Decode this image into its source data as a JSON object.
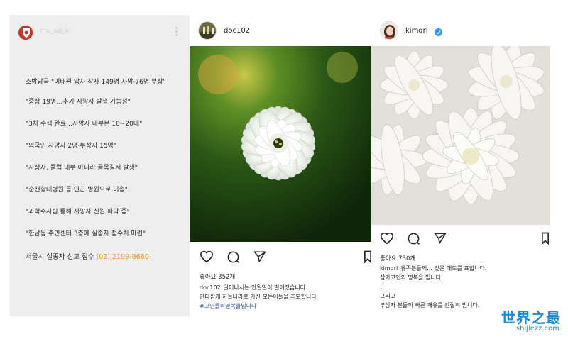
{
  "story": {
    "username": "mu_sio_k",
    "lines": [
      "소방당국 \"이태원 압사 참사 149명 사망·76명 부상\"",
      "\"중상 19명…추가 사망자 발생 가능성\"",
      "\"3차 수색 완료…사망자 대부분 10~20대\"",
      "\"외국인 사망자 2명·부상자 15명\"",
      "\"사상자, 클럽 내부 아니라 골목길서 발생\"",
      "\"순천향대병원 등 인근 병원으로 이송\"",
      "\"과학수사팀 통해 사망자 신원 파악 중\"",
      "\"한남동 주민센터 3층에 실종자 접수처 마련\""
    ],
    "contact_label": "서울시 실종자 신고 접수",
    "contact_phone": "(02) 2199-8660"
  },
  "post_doc": {
    "username": "doc102",
    "likes": "좋아요 352개",
    "caption_user": "doc102",
    "caption_lines": [
      "일어나서는 안될일이 벌어졌습니다",
      "안타깝게 하늘나라로 가신 모든이들을 추모합니다"
    ],
    "hashtag": "#고인들의명복을빕니다"
  },
  "post_kim": {
    "username": "kimqri",
    "likes": "좋아요 730개",
    "caption_user": "kimqri",
    "caption_lines": [
      "유족분들께… 깊은 애도를 표합니다.",
      "삼가고인의 명복을 빕니다.",
      ".",
      "그리고",
      "부상자 분들의 빠른 쾌유를 간절히 빕니다."
    ]
  },
  "watermark": {
    "title": "世界之最",
    "url": "shijiezz.com"
  },
  "icons": {
    "like": "heart-icon",
    "comment": "comment-icon",
    "share": "send-icon",
    "save": "bookmark-icon",
    "verified": "verified-badge-icon",
    "more": "more-vertical-icon"
  },
  "colors": {
    "story_bg": "#eeeeee",
    "phone_link": "#d9a21b",
    "hashtag": "#385898",
    "verified": "#3897f0",
    "watermark": "#1f8ad8"
  }
}
